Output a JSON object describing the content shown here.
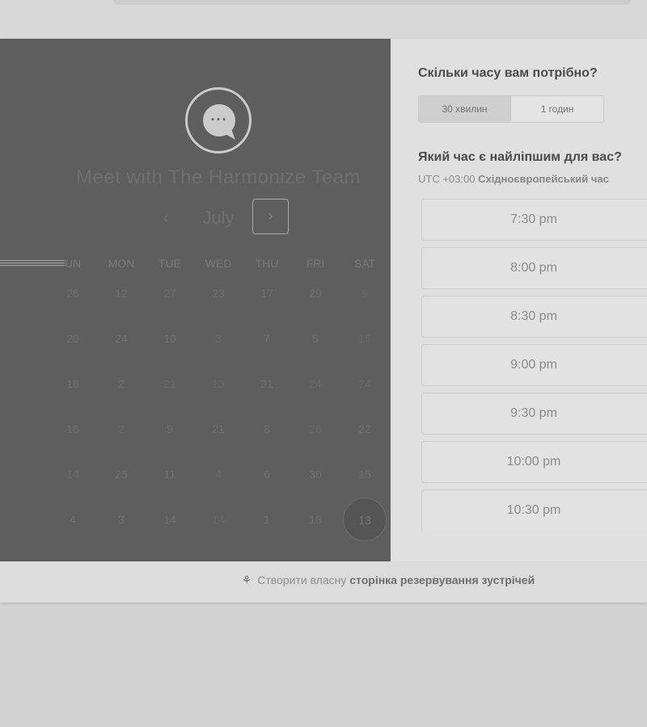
{
  "meeting": {
    "title": "Meet with The Harmonize Team",
    "logo_icon": "chat-bubble-icon"
  },
  "calendar": {
    "month": "July",
    "prev_icon": "chevron-left-icon",
    "next_icon": "chevron-right-icon",
    "weekdays": [
      "UN",
      "MON",
      "TUE",
      "WED",
      "THU",
      "FRI",
      "SAT"
    ],
    "weeks": [
      [
        "26",
        "12",
        "27",
        "23",
        "17",
        "29",
        "9"
      ],
      [
        "20",
        "24",
        "10",
        "3",
        "7",
        "5",
        "15"
      ],
      [
        "18",
        "2",
        "21",
        "13",
        "31",
        "24",
        "24"
      ],
      [
        "16",
        "2",
        "9",
        "21",
        "8",
        "26",
        "22"
      ],
      [
        "14",
        "25",
        "11",
        "4",
        "6",
        "30",
        "15"
      ],
      [
        "4",
        "3",
        "14",
        "14",
        "1",
        "18",
        "13"
      ]
    ],
    "selected_day": "13"
  },
  "duration": {
    "question": "Скільки часу вам потрібно?",
    "options": [
      "30 хвилин",
      "1 годин"
    ],
    "selected": "30 хвилин"
  },
  "time": {
    "question": "Який час є найліпшим для вас?",
    "tz_prefix": "UTC +03:00",
    "tz_name": "Східноєвропейський час",
    "slots": [
      "7:30 pm",
      "8:00 pm",
      "8:30 pm",
      "9:00 pm",
      "9:30 pm",
      "10:00 pm",
      "10:30 pm"
    ]
  },
  "footer": {
    "prefix": "Створити власну",
    "link": "сторінка резервування зустрічей",
    "icon": "hubspot-sprocket-icon"
  }
}
